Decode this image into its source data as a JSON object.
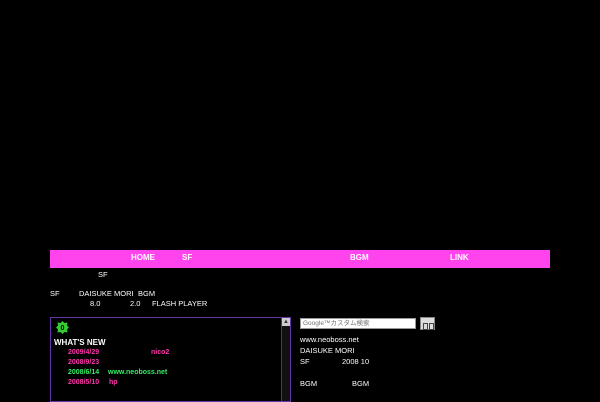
{
  "nav": {
    "items": [
      {
        "label": "HOME"
      },
      {
        "label": "SF"
      },
      {
        "label": "BGM"
      },
      {
        "label": "LINK"
      }
    ]
  },
  "intro": {
    "sf_heading": "SF",
    "line1_a": "SF",
    "line1_b": "DAISUKE MORI",
    "line1_c": "BGM",
    "line2_a": "8.0",
    "line2_b": "2.0",
    "line2_c": "FLASH PLAYER"
  },
  "news": {
    "heading": "WHAT'S NEW",
    "entries": [
      {
        "date": "2009/4/29",
        "text": "nico2",
        "color": "#ff33aa"
      },
      {
        "date": "2008/9/23",
        "text": "",
        "color": "#ff33aa"
      },
      {
        "date": "2008/6/14",
        "text": "www.neoboss.net",
        "color": "#33ee66"
      },
      {
        "date": "2008/5/10",
        "text": "hp",
        "color": "#ff33aa"
      }
    ],
    "logo_color": "#33cc33"
  },
  "search": {
    "placeholder": "Google™カスタム検索"
  },
  "sidebar": {
    "url": "www.neoboss.net",
    "author": "DAISUKE MORI",
    "sf_label": "SF",
    "year_label": "2008 10",
    "bgm_a": "BGM",
    "bgm_b": "BGM"
  },
  "colors": {
    "nav_bg": "#ff44ee",
    "page_bg": "#000000"
  }
}
